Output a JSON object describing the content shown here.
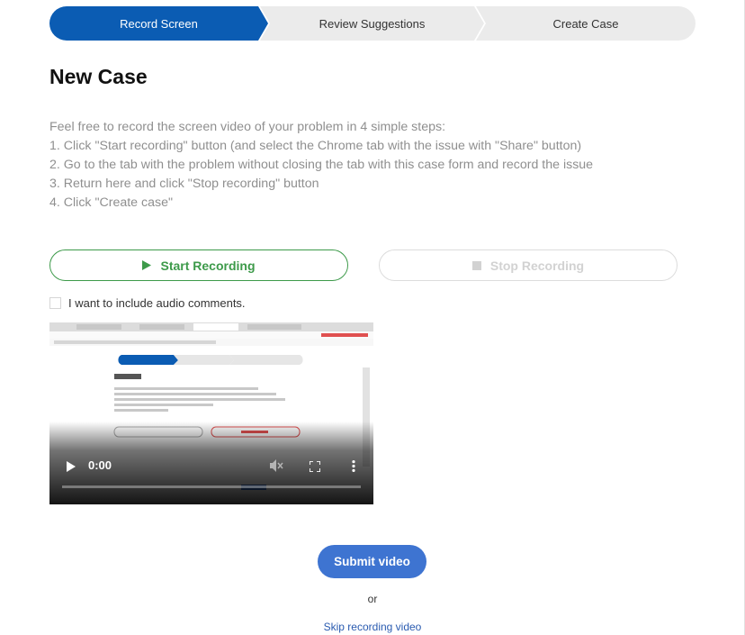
{
  "stepper": {
    "steps": [
      {
        "label": "Record Screen",
        "active": true
      },
      {
        "label": "Review Suggestions",
        "active": false
      },
      {
        "label": "Create Case",
        "active": false
      }
    ]
  },
  "page": {
    "title": "New Case"
  },
  "instructions": {
    "lines": [
      "Feel free to record the screen video of your problem in 4 simple steps:",
      "1. Click \"Start recording\" button (and select the Chrome tab with the issue with \"Share\" button)",
      "2. Go to the tab with the problem without closing the tab with this case form and record the issue",
      "3. Return here and click \"Stop recording\" button",
      "4. Click \"Create case\""
    ]
  },
  "recording": {
    "start_label": "Start Recording",
    "stop_label": "Stop Recording",
    "audio_label": "I want to include audio comments.",
    "audio_checked": false
  },
  "video": {
    "time": "0:00",
    "icons": [
      "play-icon",
      "volume-muted-icon",
      "fullscreen-icon",
      "more-options-icon"
    ]
  },
  "actions": {
    "submit_label": "Submit video",
    "or_label": "or",
    "skip_label": "Skip recording video"
  },
  "colors": {
    "active_step": "#0b5cb3",
    "inactive_step": "#ebebeb",
    "start_green": "#3d9a4a",
    "submit_blue": "#3e74d1",
    "link_blue": "#2a5bb0"
  }
}
